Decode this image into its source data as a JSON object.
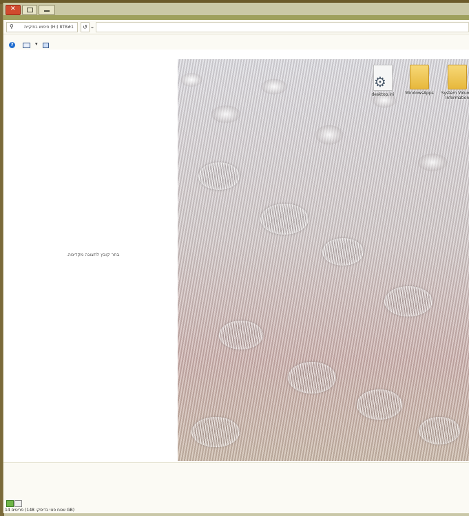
{
  "window": {
    "title_buttons": {
      "close": "close",
      "maximize": "maximize",
      "minimize": "minimize"
    }
  },
  "address_bar": {
    "search_placeholder": "חיפוש בתיקיית (H:) 8TB#1",
    "refresh_icon": "↺",
    "chevron_icon": "⌄"
  },
  "toolbar": {
    "help_icon": "?",
    "dropdown_icon": "▾"
  },
  "preview": {
    "message": "בחר קובץ לתצוגה מקדימה."
  },
  "desktop_items": [
    {
      "label": "desktop.ini",
      "icon": "settings-file-icon"
    },
    {
      "label": "WindowsApps",
      "icon": "folder-icon"
    },
    {
      "label": "System Volume Information",
      "icon": "folder-icon"
    }
  ],
  "statusbar": {
    "text": "14 פריטים (שטח פנוי בדיסק: 148 GB)"
  },
  "colors": {
    "accent_band": "#9ea05d",
    "close_red": "#d04a2e",
    "help_blue": "#1e6ccf"
  }
}
